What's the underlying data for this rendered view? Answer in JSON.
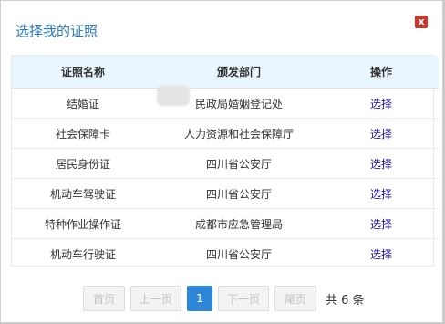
{
  "dialog": {
    "title": "选择我的证照",
    "close_glyph": "x"
  },
  "table": {
    "headers": [
      "证照名称",
      "颁发部门",
      "操作"
    ],
    "rows": [
      {
        "name": "结婚证",
        "dept": "民政局婚姻登记处",
        "action": "选择"
      },
      {
        "name": "社会保障卡",
        "dept": "人力资源和社会保障厅",
        "action": "选择"
      },
      {
        "name": "居民身份证",
        "dept": "四川省公安厅",
        "action": "选择"
      },
      {
        "name": "机动车驾驶证",
        "dept": "四川省公安厅",
        "action": "选择"
      },
      {
        "name": "特种作业操作证",
        "dept": "成都市应急管理局",
        "action": "选择"
      },
      {
        "name": "机动车行驶证",
        "dept": "四川省公安厅",
        "action": "选择"
      }
    ]
  },
  "pager": {
    "first": "首页",
    "prev": "上一页",
    "current": "1",
    "next": "下一页",
    "last": "尾页",
    "total": "共 6 条"
  },
  "colors": {
    "title": "#2c78c2",
    "close": "#c9382a",
    "header_bg": "#eaf6fd",
    "link": "#1a0dab",
    "current_page": "#2e87d6"
  }
}
